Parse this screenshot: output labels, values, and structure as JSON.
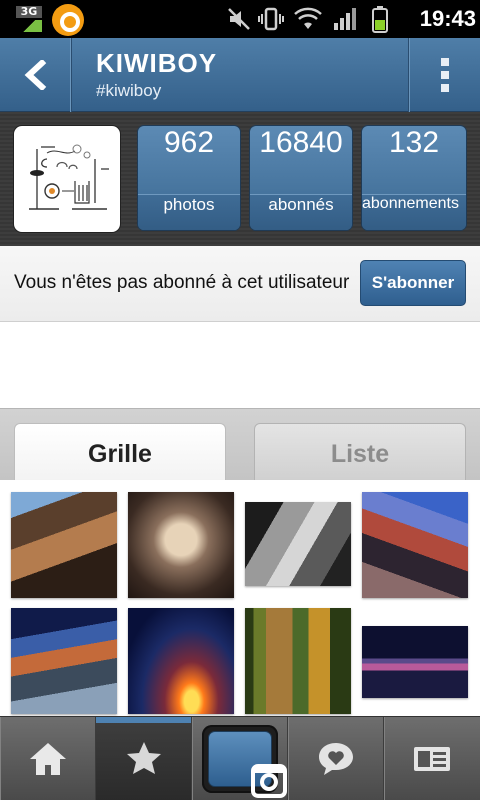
{
  "status_bar": {
    "network": "3G",
    "time": "19:43",
    "icons": [
      "network-3g-icon",
      "notification-app-icon",
      "mute-icon",
      "vibrate-icon",
      "wifi-icon",
      "signal-icon",
      "battery-icon"
    ]
  },
  "header": {
    "title": "KIWIBOY",
    "subtitle": "#kiwiboy",
    "back_icon": "back-arrow-icon",
    "menu_icon": "overflow-menu-icon"
  },
  "profile": {
    "stats": [
      {
        "value": "962",
        "label": "photos"
      },
      {
        "value": "16840",
        "label": "abonnés"
      },
      {
        "value": "132",
        "label": "abonnements"
      }
    ]
  },
  "follow": {
    "message": "Vous n'êtes pas abonné à cet utilisateur",
    "button_label": "S'abonner"
  },
  "tabs": [
    {
      "label": "Grille",
      "active": true
    },
    {
      "label": "Liste",
      "active": false
    }
  ],
  "photos": [
    "photo-building",
    "photo-trees",
    "photo-tunnel",
    "photo-street",
    "photo-highway",
    "photo-sunset",
    "photo-forest",
    "photo-bridge-night"
  ],
  "bottom_nav": [
    {
      "icon": "home-icon"
    },
    {
      "icon": "star-icon",
      "active": true
    },
    {
      "icon": "camera-icon"
    },
    {
      "icon": "heart-bubble-icon"
    },
    {
      "icon": "profile-card-icon"
    }
  ],
  "colors": {
    "accent": "#3a6891",
    "header": "#4f7ea8"
  }
}
